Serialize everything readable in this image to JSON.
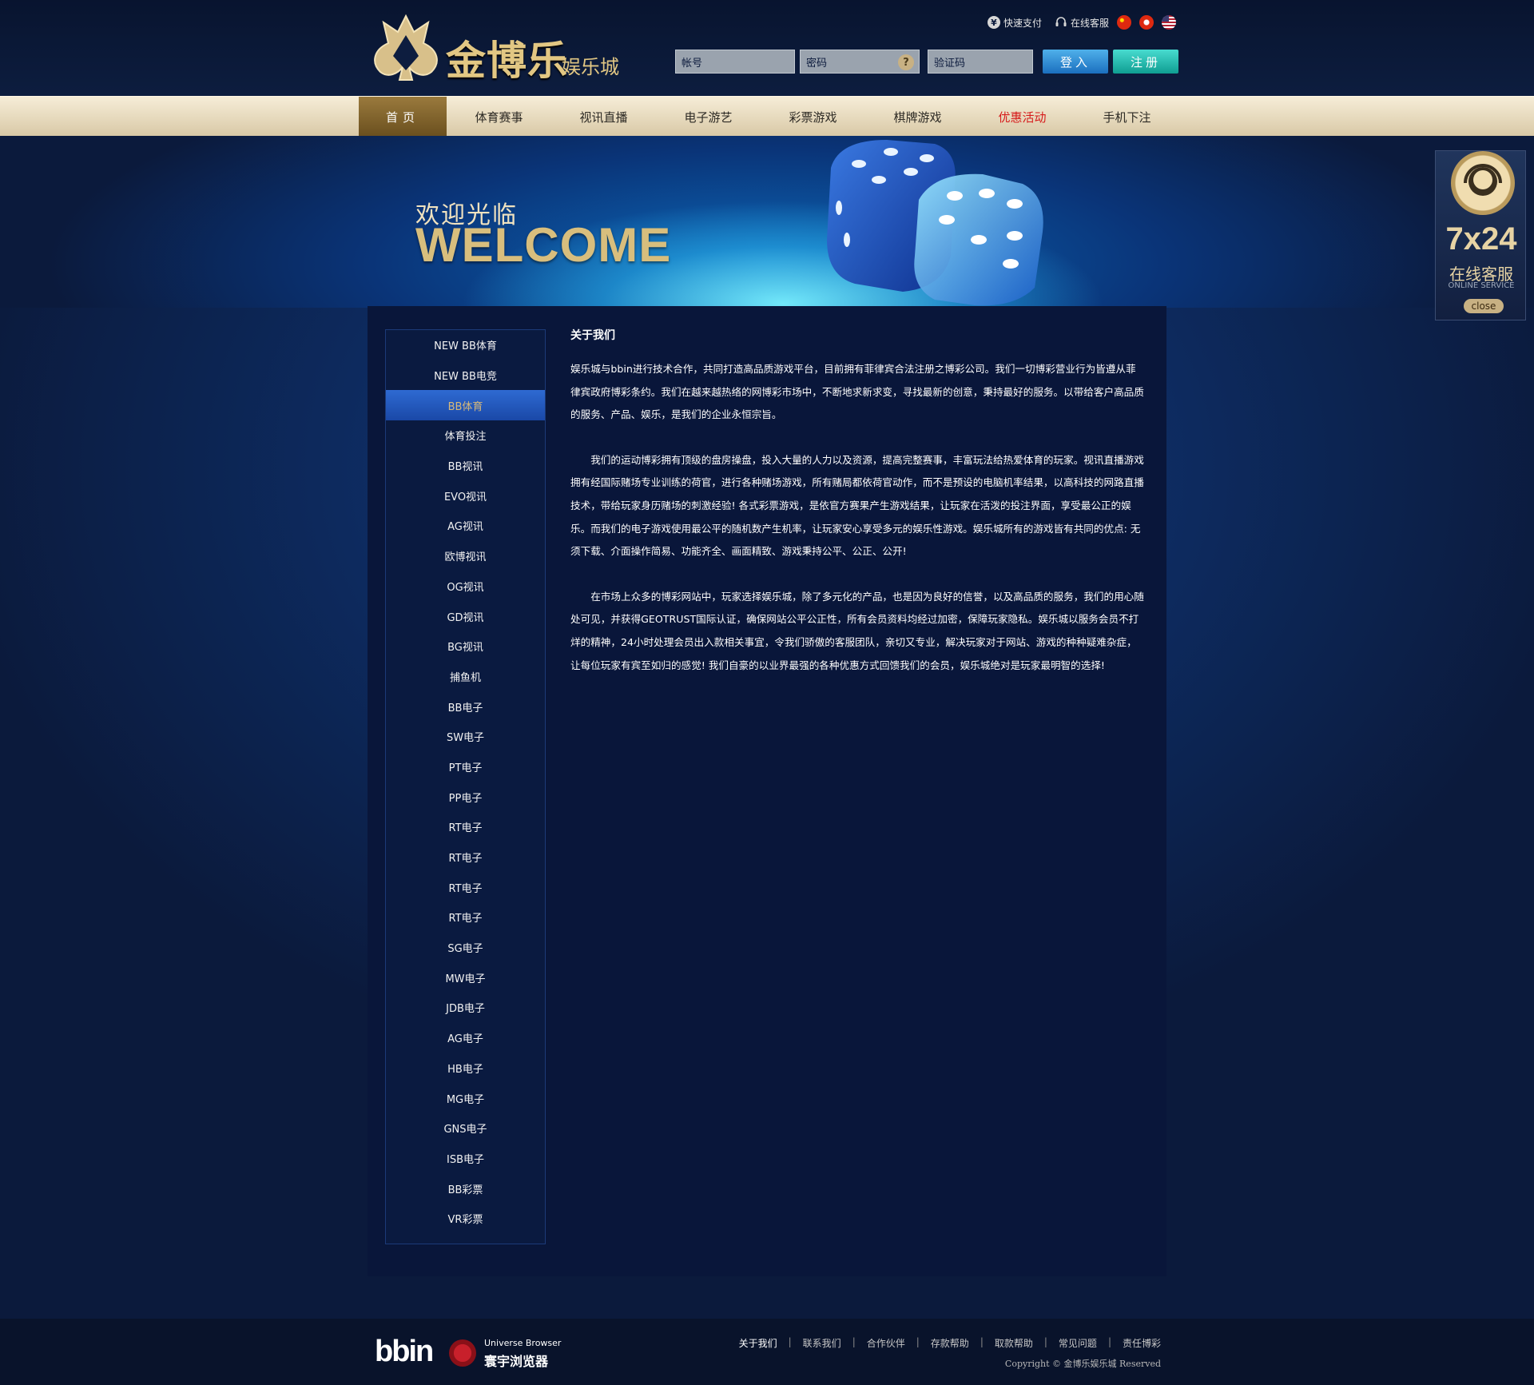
{
  "header": {
    "logo_main": "金博乐",
    "logo_sub": "娱乐城",
    "topbar": {
      "quick_pay": "快速支付",
      "online_service": "在线客服"
    },
    "login": {
      "account_placeholder": "帐号",
      "password_placeholder": "密码",
      "captcha_placeholder": "验证码",
      "login_label": "登入",
      "register_label": "注册",
      "help_glyph": "?"
    }
  },
  "nav": {
    "items": [
      {
        "label": "首页"
      },
      {
        "label": "体育赛事"
      },
      {
        "label": "视讯直播"
      },
      {
        "label": "电子游艺"
      },
      {
        "label": "彩票游戏"
      },
      {
        "label": "棋牌游戏"
      },
      {
        "label": "优惠活动"
      },
      {
        "label": "手机下注"
      }
    ]
  },
  "banner": {
    "welcome_cn": "欢迎光临",
    "welcome_en": "WELCOME"
  },
  "sidebar": {
    "items": [
      "NEW BB体育",
      "NEW BB电竞",
      "BB体育",
      "体育投注",
      "BB视讯",
      "EVO视讯",
      "AG视讯",
      "欧博视讯",
      "OG视讯",
      "GD视讯",
      "BG视讯",
      "捕鱼机",
      "BB电子",
      "SW电子",
      "PT电子",
      "PP电子",
      "RT电子",
      "RT电子",
      "RT电子",
      "RT电子",
      "SG电子",
      "MW电子",
      "JDB电子",
      "AG电子",
      "HB电子",
      "MG电子",
      "GNS电子",
      "ISB电子",
      "BB彩票",
      "VR彩票"
    ],
    "active_index": 2
  },
  "content": {
    "title": "关于我们",
    "p1": "娱乐城与bbin进行技术合作，共同打造高品质游戏平台，目前拥有菲律宾合法注册之博彩公司。我们一切博彩营业行为皆遵从菲律宾政府博彩条约。我们在越来越热络的网博彩市场中，不断地求新求变，寻找最新的创意，秉持最好的服务。以带给客户高品质的服务、产品、娱乐，是我们的企业永恒宗旨。",
    "p2": "我们的运动博彩拥有顶级的盘房操盘，投入大量的人力以及资源，提高完整赛事，丰富玩法给热爱体育的玩家。视讯直播游戏拥有经国际赌场专业训练的荷官，进行各种赌场游戏，所有赌局都依荷官动作，而不是预设的电脑机率结果，以高科技的网路直播技术，带给玩家身历赌场的刺激经验! 各式彩票游戏，是依官方赛果产生游戏结果，让玩家在活泼的投注界面，享受最公正的娱乐。而我们的电子游戏使用最公平的随机数产生机率，让玩家安心享受多元的娱乐性游戏。娱乐城所有的游戏皆有共同的优点: 无须下载、介面操作简易、功能齐全、画面精致、游戏秉持公平、公正、公开!",
    "p3": "在市场上众多的博彩网站中，玩家选择娱乐城，除了多元化的产品，也是因为良好的信誉，以及高品质的服务，我们的用心随处可见，并获得GEOTRUST国际认证，确保网站公平公正性，所有会员资料均经过加密，保障玩家隐私。娱乐城以服务会员不打烊的精神，24小时处理会员出入款相关事宜，令我们骄傲的客服团队，亲切又专业，解决玩家对于网站、游戏的种种疑难杂症，让每位玩家有宾至如归的感觉! 我们自豪的以业界最强的各种优惠方式回馈我们的会员，娱乐城绝对是玩家最明智的选择!"
  },
  "float_service": {
    "hours": "7x24",
    "title_cn": "在线客服",
    "title_en": "ONLINE SERVICE",
    "close_label": "close"
  },
  "footer": {
    "bbin_logo": "bbin",
    "browser_en": "Universe Browser",
    "browser_cn": "寰宇浏览器",
    "links": [
      "关于我们",
      "联系我们",
      "合作伙伴",
      "存款帮助",
      "取款帮助",
      "常见问题",
      "责任博彩"
    ],
    "copyright": "Copyright ©  金博乐娱乐城  Reserved"
  },
  "colors": {
    "page_bg": "#0b1a3c",
    "gold": "#e2c783",
    "nav_bg": "#e9dcc0",
    "promo_red": "#d61a1a",
    "login_blue": "#1b6fbf",
    "register_teal": "#0f9e92",
    "sidebar_active": "#2559bf"
  }
}
